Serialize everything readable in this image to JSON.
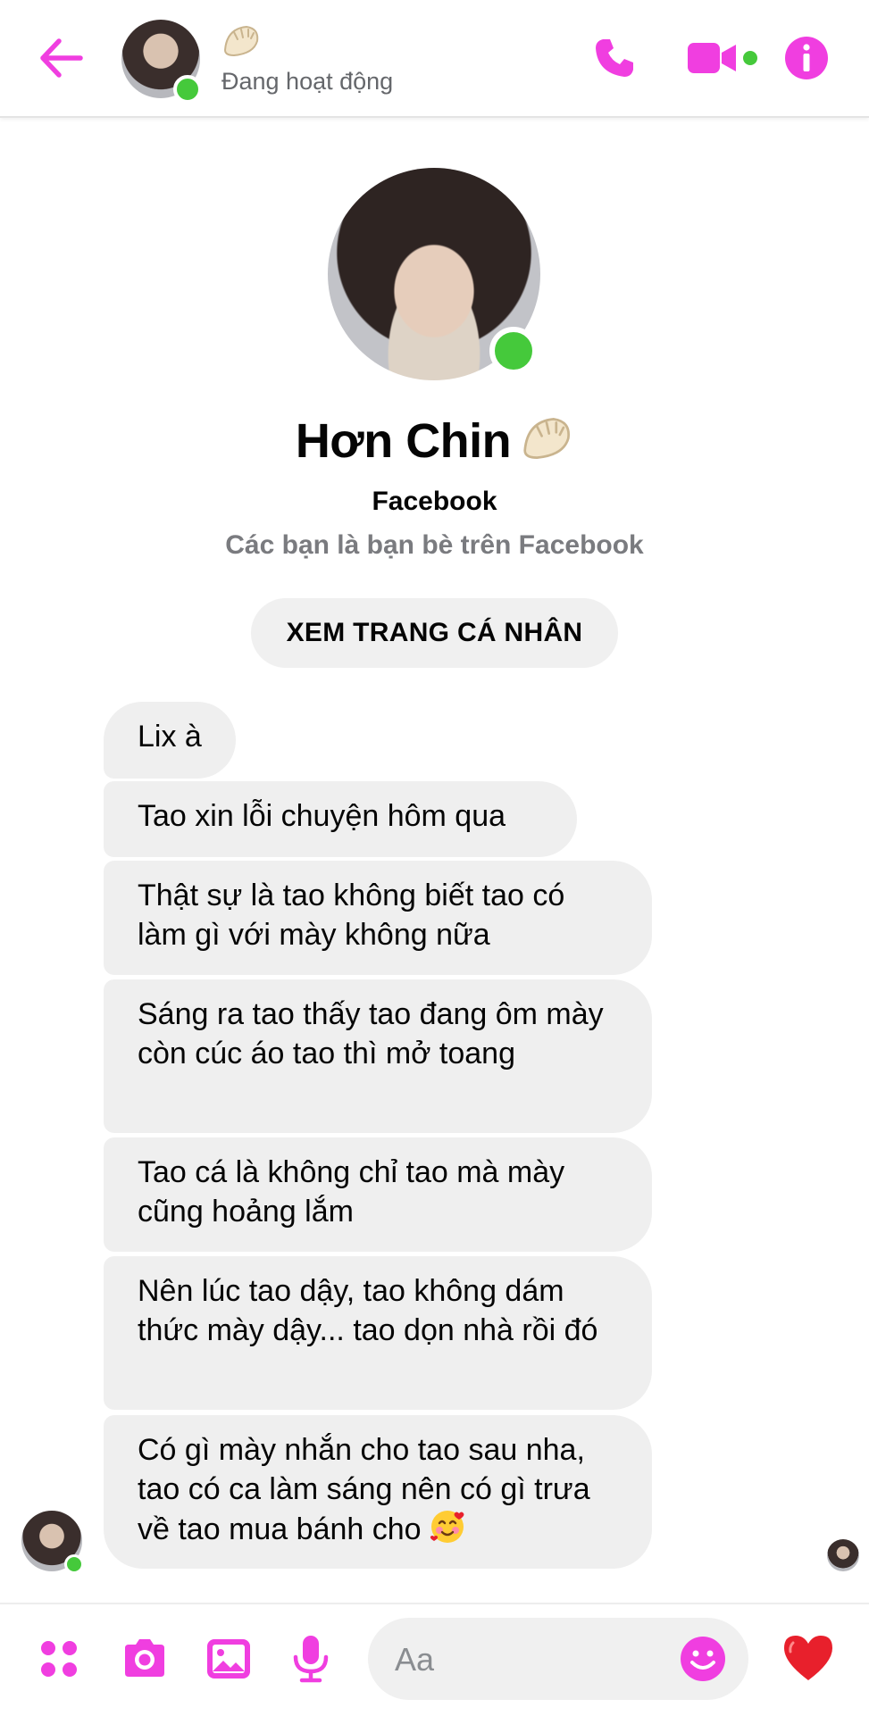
{
  "colors": {
    "accent": "#f03ee0",
    "online": "#45c93b",
    "bubble_bg": "#efefef",
    "heart": "#e8202c"
  },
  "header": {
    "status": "Đang hoạt động",
    "emoji_icon": "dumpling-emoji-icon",
    "icons": [
      "back-arrow-icon",
      "phone-icon",
      "video-camera-icon",
      "info-icon"
    ]
  },
  "profile": {
    "name": "Hơn Chin",
    "platform": "Facebook",
    "relationship": "Các bạn là bạn bè trên Facebook",
    "view_profile_label": "XEM TRANG CÁ NHÂN"
  },
  "messages": [
    {
      "text": "Lix à"
    },
    {
      "text": "Tao xin lỗi chuyện hôm qua"
    },
    {
      "text": "Thật sự là tao không biết tao có làm gì với mày không nữa"
    },
    {
      "text": "Sáng ra tao thấy tao đang ôm mày còn cúc áo tao thì mở toang"
    },
    {
      "text": "Tao cá là không chỉ tao mà mày cũng hoảng lắm"
    },
    {
      "text": "Nên lúc tao dậy, tao không dám thức mày dậy... tao dọn nhà rồi đó"
    },
    {
      "text": "Có gì mày nhắn cho tao sau nha, tao có ca làm sáng nên có gì trưa về tao mua bánh cho",
      "emoji_icon": "smiling-face-with-hearts-icon"
    }
  ],
  "composer": {
    "placeholder": "Aa",
    "icons": [
      "apps-grid-icon",
      "camera-icon",
      "gallery-icon",
      "microphone-icon",
      "emoji-icon",
      "heart-like-icon"
    ]
  }
}
